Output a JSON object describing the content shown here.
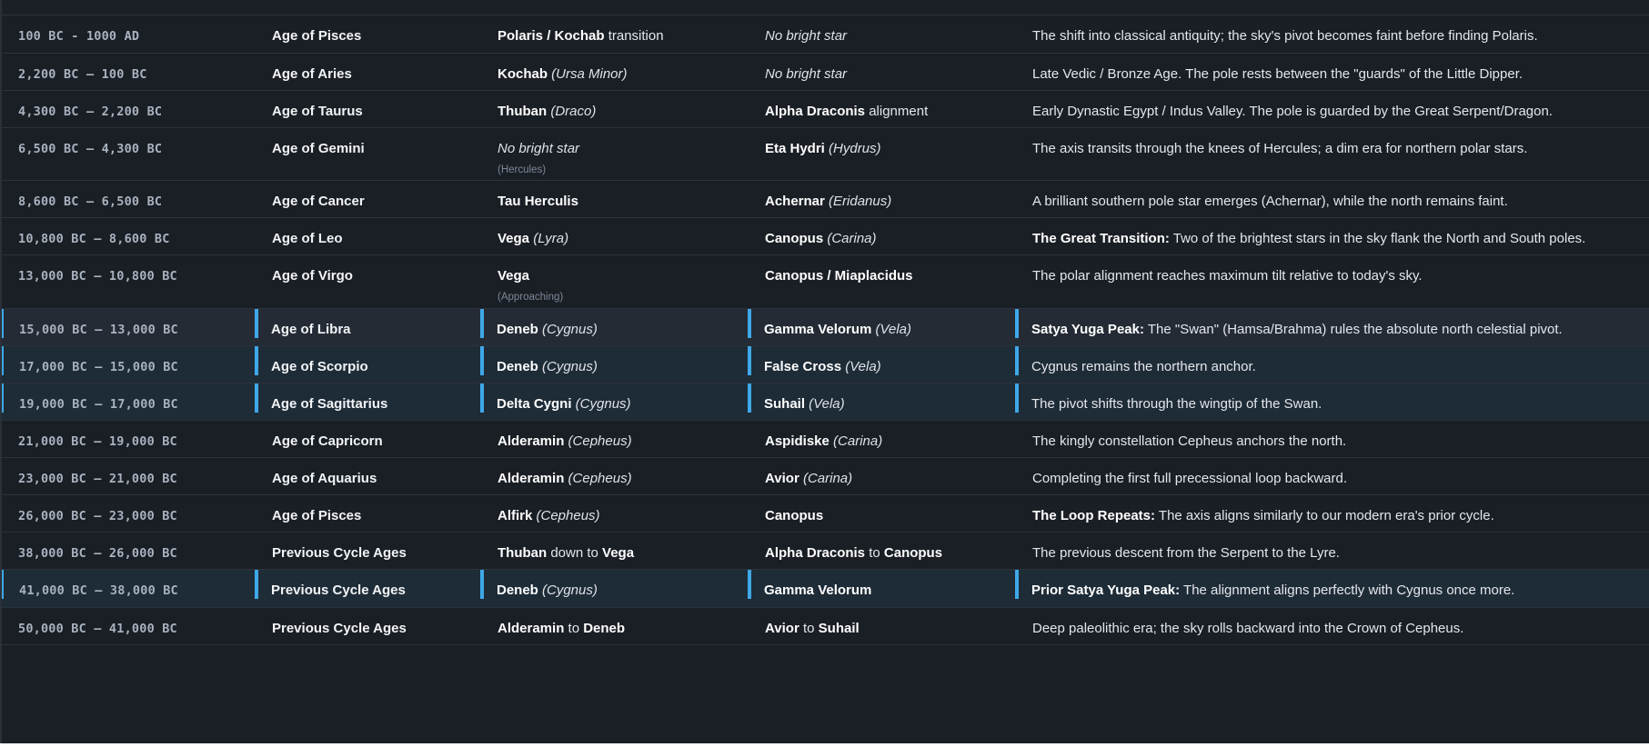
{
  "rows": [
    {
      "date": "100 BC - 1000 AD",
      "age": "Age of Pisces",
      "north": [
        {
          "t": "Polaris / Kochab",
          "s": "b"
        },
        {
          "t": " transition",
          "s": "n"
        }
      ],
      "north_sub": "",
      "south": [
        {
          "t": "No bright star",
          "s": "i"
        }
      ],
      "note": [
        {
          "t": "The shift into classical antiquity; the sky's pivot becomes faint before finding Polaris.",
          "s": "n"
        }
      ],
      "highlight": false
    },
    {
      "date": "2,200 BC – 100 BC",
      "age": "Age of Aries",
      "north": [
        {
          "t": "Kochab",
          "s": "b"
        },
        {
          "t": " (Ursa Minor)",
          "s": "i"
        }
      ],
      "north_sub": "",
      "south": [
        {
          "t": "No bright star",
          "s": "i"
        }
      ],
      "note": [
        {
          "t": "Late Vedic / Bronze Age. The pole rests between the \"guards\" of the Little Dipper.",
          "s": "n"
        }
      ],
      "highlight": false
    },
    {
      "date": "4,300 BC – 2,200 BC",
      "age": "Age of Taurus",
      "north": [
        {
          "t": "Thuban",
          "s": "b"
        },
        {
          "t": " (Draco)",
          "s": "i"
        }
      ],
      "north_sub": "",
      "south": [
        {
          "t": "Alpha Draconis",
          "s": "b"
        },
        {
          "t": " alignment",
          "s": "n"
        }
      ],
      "note": [
        {
          "t": "Early Dynastic Egypt / Indus Valley. The pole is guarded by the Great Serpent/Dragon.",
          "s": "n"
        }
      ],
      "highlight": false
    },
    {
      "date": "6,500 BC – 4,300 BC",
      "age": "Age of Gemini",
      "north": [
        {
          "t": "No bright star",
          "s": "i"
        }
      ],
      "north_sub": "(Hercules)",
      "south": [
        {
          "t": "Eta Hydri",
          "s": "b"
        },
        {
          "t": " (Hydrus)",
          "s": "i"
        }
      ],
      "note": [
        {
          "t": "The axis transits through the knees of Hercules; a dim era for northern polar stars.",
          "s": "n"
        }
      ],
      "highlight": false
    },
    {
      "date": "8,600 BC – 6,500 BC",
      "age": "Age of Cancer",
      "north": [
        {
          "t": "Tau Herculis",
          "s": "b"
        }
      ],
      "north_sub": "",
      "south": [
        {
          "t": "Achernar",
          "s": "b"
        },
        {
          "t": " (Eridanus)",
          "s": "i"
        }
      ],
      "note": [
        {
          "t": "A brilliant southern pole star emerges (Achernar), while the north remains faint.",
          "s": "n"
        }
      ],
      "highlight": false
    },
    {
      "date": "10,800 BC – 8,600 BC",
      "age": "Age of Leo",
      "north": [
        {
          "t": "Vega",
          "s": "b"
        },
        {
          "t": " (Lyra)",
          "s": "i"
        }
      ],
      "north_sub": "",
      "south": [
        {
          "t": "Canopus",
          "s": "b"
        },
        {
          "t": " (Carina)",
          "s": "i"
        }
      ],
      "note": [
        {
          "t": "The Great Transition:",
          "s": "b"
        },
        {
          "t": " Two of the brightest stars in the sky flank the North and South poles.",
          "s": "n"
        }
      ],
      "highlight": false
    },
    {
      "date": "13,000 BC – 10,800 BC",
      "age": "Age of Virgo",
      "north": [
        {
          "t": "Vega",
          "s": "b"
        }
      ],
      "north_sub": "(Approaching)",
      "south": [
        {
          "t": "Canopus / Miaplacidus",
          "s": "b"
        }
      ],
      "note": [
        {
          "t": "The polar alignment reaches maximum tilt relative to today's sky.",
          "s": "n"
        }
      ],
      "highlight": false
    },
    {
      "date": "15,000 BC – 13,000 BC",
      "age": "Age of Libra",
      "north": [
        {
          "t": "Deneb",
          "s": "b"
        },
        {
          "t": " (Cygnus)",
          "s": "i"
        }
      ],
      "north_sub": "",
      "south": [
        {
          "t": "Gamma Velorum",
          "s": "b"
        },
        {
          "t": " (Vela)",
          "s": "i"
        }
      ],
      "note": [
        {
          "t": "Satya Yuga Peak:",
          "s": "b"
        },
        {
          "t": " The \"Swan\" (Hamsa/Brahma) rules the absolute north celestial pivot.",
          "s": "n"
        }
      ],
      "highlight": true
    },
    {
      "date": "17,000 BC – 15,000 BC",
      "age": "Age of Scorpio",
      "north": [
        {
          "t": "Deneb",
          "s": "b"
        },
        {
          "t": " (Cygnus)",
          "s": "i"
        }
      ],
      "north_sub": "",
      "south": [
        {
          "t": "False Cross",
          "s": "b"
        },
        {
          "t": " (Vela)",
          "s": "i"
        }
      ],
      "note": [
        {
          "t": "Cygnus remains the northern anchor.",
          "s": "n"
        }
      ],
      "highlight": true
    },
    {
      "date": "19,000 BC – 17,000 BC",
      "age": "Age of Sagittarius",
      "north": [
        {
          "t": "Delta Cygni",
          "s": "b"
        },
        {
          "t": " (Cygnus)",
          "s": "i"
        }
      ],
      "north_sub": "",
      "south": [
        {
          "t": "Suhail",
          "s": "b"
        },
        {
          "t": " (Vela)",
          "s": "i"
        }
      ],
      "note": [
        {
          "t": "The pivot shifts through the wingtip of the Swan.",
          "s": "n"
        }
      ],
      "highlight": true
    },
    {
      "date": "21,000 BC – 19,000 BC",
      "age": "Age of Capricorn",
      "north": [
        {
          "t": "Alderamin",
          "s": "b"
        },
        {
          "t": " (Cepheus)",
          "s": "i"
        }
      ],
      "north_sub": "",
      "south": [
        {
          "t": "Aspidiske",
          "s": "b"
        },
        {
          "t": " (Carina)",
          "s": "i"
        }
      ],
      "note": [
        {
          "t": "The kingly constellation Cepheus anchors the north.",
          "s": "n"
        }
      ],
      "highlight": false
    },
    {
      "date": "23,000 BC – 21,000 BC",
      "age": "Age of Aquarius",
      "north": [
        {
          "t": "Alderamin",
          "s": "b"
        },
        {
          "t": " (Cepheus)",
          "s": "i"
        }
      ],
      "north_sub": "",
      "south": [
        {
          "t": "Avior",
          "s": "b"
        },
        {
          "t": " (Carina)",
          "s": "i"
        }
      ],
      "note": [
        {
          "t": "Completing the first full precessional loop backward.",
          "s": "n"
        }
      ],
      "highlight": false
    },
    {
      "date": "26,000 BC – 23,000 BC",
      "age": "Age of Pisces",
      "north": [
        {
          "t": "Alfirk",
          "s": "b"
        },
        {
          "t": " (Cepheus)",
          "s": "i"
        }
      ],
      "north_sub": "",
      "south": [
        {
          "t": "Canopus",
          "s": "b"
        }
      ],
      "note": [
        {
          "t": "The Loop Repeats:",
          "s": "b"
        },
        {
          "t": " The axis aligns similarly to our modern era's prior cycle.",
          "s": "n"
        }
      ],
      "highlight": false
    },
    {
      "date": "38,000 BC – 26,000 BC",
      "age": "Previous Cycle Ages",
      "north": [
        {
          "t": "Thuban",
          "s": "b"
        },
        {
          "t": " down to ",
          "s": "n"
        },
        {
          "t": "Vega",
          "s": "b"
        }
      ],
      "north_sub": "",
      "south": [
        {
          "t": "Alpha Draconis",
          "s": "b"
        },
        {
          "t": " to ",
          "s": "n"
        },
        {
          "t": "Canopus",
          "s": "b"
        }
      ],
      "note": [
        {
          "t": "The previous descent from the Serpent to the Lyre.",
          "s": "n"
        }
      ],
      "highlight": false
    },
    {
      "date": "41,000 BC – 38,000 BC",
      "age": "Previous Cycle Ages",
      "north": [
        {
          "t": "Deneb",
          "s": "b"
        },
        {
          "t": " (Cygnus)",
          "s": "i"
        }
      ],
      "north_sub": "",
      "south": [
        {
          "t": "Gamma Velorum",
          "s": "b"
        }
      ],
      "note": [
        {
          "t": "Prior Satya Yuga Peak:",
          "s": "b"
        },
        {
          "t": " The alignment aligns perfectly with Cygnus once more.",
          "s": "n"
        }
      ],
      "highlight": true
    },
    {
      "date": "50,000 BC – 41,000 BC",
      "age": "Previous Cycle Ages",
      "north": [
        {
          "t": "Alderamin",
          "s": "b"
        },
        {
          "t": " to ",
          "s": "n"
        },
        {
          "t": "Deneb",
          "s": "b"
        }
      ],
      "north_sub": "",
      "south": [
        {
          "t": "Avior",
          "s": "b"
        },
        {
          "t": " to ",
          "s": "n"
        },
        {
          "t": "Suhail",
          "s": "b"
        }
      ],
      "note": [
        {
          "t": "Deep paleolithic era; the sky rolls backward into the Crown of Cepheus.",
          "s": "n"
        }
      ],
      "highlight": false
    }
  ],
  "colors": {
    "background": "#1a1e25",
    "highlight_row": "#1e2c38",
    "accent_border": "#3ea8e8",
    "date_text": "#a9b3bf"
  }
}
